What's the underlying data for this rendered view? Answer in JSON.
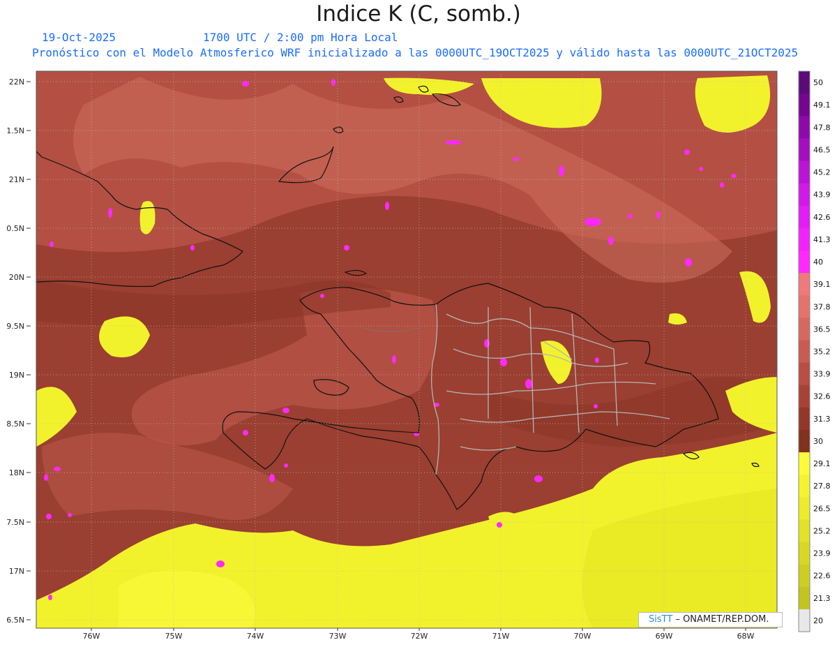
{
  "header": {
    "title": "Indice K (C, somb.)",
    "date": "19-Oct-2025",
    "time": "1700 UTC / 2:00 pm Hora Local",
    "description": "Pronóstico con el Modelo Atmosferico WRF inicializado a las 0000UTC_19OCT2025 y válido hasta las  0000UTC_21OCT2025"
  },
  "map": {
    "lat_range": [
      16.4,
      22.1
    ],
    "lon_range": [
      -76.65,
      -67.65
    ],
    "lat_labels": [
      "22N",
      "1.5N",
      "21N",
      "0.5N",
      "20N",
      "9.5N",
      "19N",
      "8.5N",
      "18N",
      "7.5N",
      "17N",
      "6.5N"
    ],
    "lon_labels": [
      "76W",
      "75W",
      "74W",
      "73W",
      "72W",
      "71W",
      "70W",
      "69W",
      "68W"
    ]
  },
  "colorbar": {
    "labels": [
      "50",
      "49.1",
      "47.8",
      "46.5",
      "45.2",
      "43.9",
      "42.6",
      "41.3",
      "40",
      "39.1",
      "37.8",
      "36.5",
      "35.2",
      "33.9",
      "32.6",
      "31.3",
      "30",
      "29.1",
      "27.8",
      "26.5",
      "25.2",
      "23.9",
      "22.6",
      "21.3",
      "20"
    ],
    "colors": [
      "#5c0a7a",
      "#76058f",
      "#8d0aa8",
      "#a30fc0",
      "#bb14d6",
      "#d21ae8",
      "#e31df5",
      "#f122fb",
      "#ff28ff",
      "#f07a7a",
      "#e4736c",
      "#d8685f",
      "#c85b52",
      "#b94e44",
      "#a84236",
      "#95362a",
      "#83301c",
      "#fbfb3a",
      "#f4f42e",
      "#ecec2a",
      "#e2e226",
      "#d8d822",
      "#cece20",
      "#c4c41e",
      "#e8e8e8"
    ]
  },
  "credit": {
    "logo": "SisTT",
    "text": "– ONAMET/REP.DOM."
  }
}
